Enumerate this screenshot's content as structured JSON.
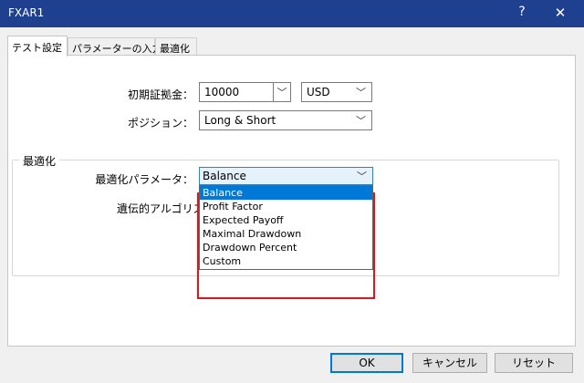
{
  "window": {
    "title": "FXAR1",
    "help_glyph": "?",
    "close_glyph": "✕"
  },
  "tabs": [
    {
      "label": "テスト設定",
      "active": true
    },
    {
      "label": "パラメーターの入力",
      "active": false
    },
    {
      "label": "最適化",
      "active": false
    }
  ],
  "deposit": {
    "label": "初期証拠金：",
    "value": "10000",
    "currency": "USD"
  },
  "position": {
    "label": "ポジション：",
    "value": "Long & Short"
  },
  "optimization": {
    "group_title": "最適化",
    "param_label": "最適化パラメータ：",
    "param_value": "Balance",
    "genetic_label": "遺伝的アルゴリズム",
    "options": [
      "Balance",
      "Profit Factor",
      "Expected Payoff",
      "Maximal Drawdown",
      "Drawdown Percent",
      "Custom"
    ],
    "selected_index": 0,
    "highlight_color": "#e0141d"
  },
  "buttons": {
    "ok": "OK",
    "cancel": "キャンセル",
    "reset": "リセット"
  },
  "icons": {
    "chevron": "﹀"
  }
}
